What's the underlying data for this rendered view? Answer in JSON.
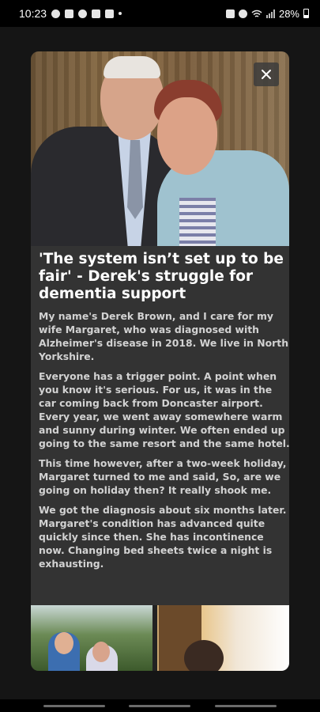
{
  "status_bar": {
    "time": "10:23",
    "battery": "28%",
    "left_icons": [
      "messenger-icon",
      "instagram-icon",
      "notification-icon",
      "gmail-icon",
      "mail-icon",
      "dot-icon"
    ],
    "right_icons": [
      "nfc-icon",
      "alarm-icon",
      "wifi-icon",
      "signal-icon",
      "battery-icon"
    ]
  },
  "article": {
    "title": "'The system isn’t set up to be fair' - Derek's struggle for dementia support",
    "paragraphs": [
      "My name's Derek Brown, and I care for my wife Margaret, who was diagnosed with Alzheimer's disease in 2018. We live in North Yorkshire.",
      "Everyone has a trigger point. A point when you know it's serious. For us, it was in the car coming back from Doncaster airport. Every year, we went away somewhere warm and sunny during winter. We often ended up going to the same resort and the same hotel.",
      "This time however, after a two-week holiday, Margaret turned to me and said, So, are we going on holiday then? It really shook me.",
      "We got the diagnosis about six months later. Margaret's condition has advanced quite quickly since then. She has incontinence now. Changing bed sheets twice a night is exhausting."
    ]
  },
  "modal": {
    "close_icon": "close-icon"
  },
  "colors": {
    "background": "#151515",
    "card": "#333333",
    "title_text": "#ffffff",
    "body_text": "#d2d2d2"
  }
}
